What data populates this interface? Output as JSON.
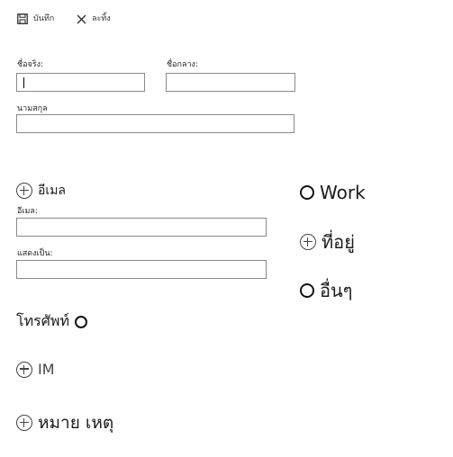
{
  "toolbar": {
    "save_label": "บันทึก",
    "discard_label": "ละทิ้ง"
  },
  "name_fields": {
    "first_name_label": "ชื่อจริง:",
    "middle_name_label": "ชื่อกลาง:",
    "last_name_label": "นามสกุล"
  },
  "email_section": {
    "add_label": "อีเมล",
    "email_label": "อีเมล:",
    "display_as_label": "แสดงเป็น:"
  },
  "phone_section": {
    "label": "โทรศัพท์"
  },
  "im_section": {
    "label": "IM"
  },
  "notes_section": {
    "label": "หมาย เหตุ"
  },
  "right_column": {
    "work_label": "Work",
    "address_label": "ที่อยู่",
    "other_label": "อื่นๆ"
  }
}
